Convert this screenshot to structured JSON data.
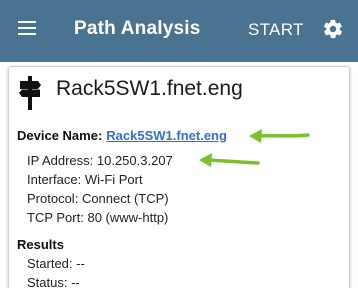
{
  "appbar": {
    "title": "Path Analysis",
    "start_label": "START",
    "menu_icon": "hamburger-menu-icon",
    "settings_icon": "gear-icon",
    "background": "#4a7391"
  },
  "card": {
    "device_icon": "signpost-icon",
    "device_heading": "Rack5SW1.fnet.eng",
    "device_name_label": "Device Name:",
    "device_name_value": "Rack5SW1.fnet.eng",
    "details": [
      {
        "label": "IP Address:",
        "value": "10.250.3.207"
      },
      {
        "label": "Interface:",
        "value": "Wi-Fi Port"
      },
      {
        "label": "Protocol:",
        "value": "Connect (TCP)"
      },
      {
        "label": "TCP Port:",
        "value": "80 (www-http)"
      }
    ],
    "results_heading": "Results",
    "results": [
      {
        "label": "Started:",
        "value": "--"
      },
      {
        "label": "Status:",
        "value": "--"
      }
    ]
  },
  "annotations": {
    "arrow_color": "#7cc12b"
  }
}
